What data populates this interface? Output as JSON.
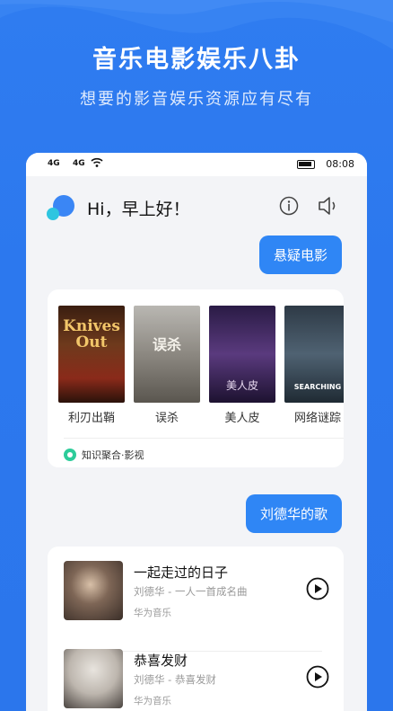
{
  "promo": {
    "headline": "音乐电影娱乐八卦",
    "subline": "想要的影音娱乐资源应有尽有"
  },
  "statusbar": {
    "signal1": "4G",
    "signal2": "4G",
    "time": "08:08"
  },
  "chat": {
    "greeting": "Hi，早上好！",
    "query1": "悬疑电影",
    "query2": "刘德华的歌"
  },
  "movies": {
    "items": [
      {
        "title": "利刃出鞘",
        "poster_text": "Knives Out"
      },
      {
        "title": "误杀",
        "poster_text": "误杀"
      },
      {
        "title": "美人皮",
        "poster_text": "美人皮"
      },
      {
        "title": "网络谜踪",
        "poster_text": "SEARCHING"
      }
    ],
    "source": "知识聚合·影视"
  },
  "songs": {
    "items": [
      {
        "title": "一起走过的日子",
        "subtitle": "刘德华 - 一人一首成名曲",
        "source": "华为音乐"
      },
      {
        "title": "恭喜发财",
        "subtitle": "刘德华 - 恭喜发财",
        "source": "华为音乐"
      }
    ]
  },
  "colors": {
    "background": "#2c78ee",
    "bubble": "#2f86f5",
    "source_dot": "#2dcc9a"
  }
}
